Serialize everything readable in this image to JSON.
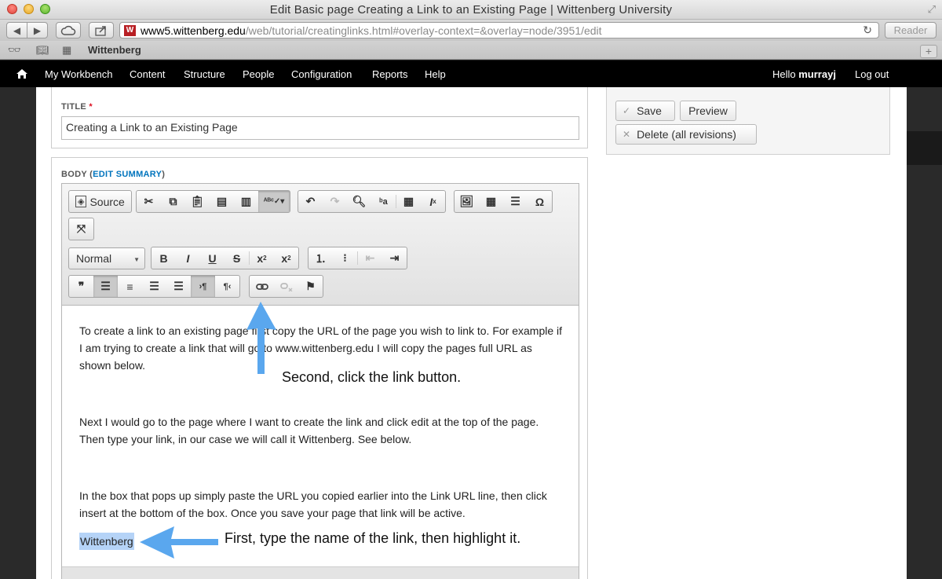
{
  "window": {
    "title": "Edit Basic page Creating a Link to an Existing Page | Wittenberg University"
  },
  "browser": {
    "url_host": "www5.wittenberg.edu",
    "url_rest": "/web/tutorial/creatinglinks.html#overlay-context=&overlay=node/3951/edit",
    "reader_label": "Reader",
    "bookmark_label": "Wittenberg",
    "icons": [
      "back-icon",
      "forward-icon",
      "icloud-icon",
      "share-icon",
      "reload-icon",
      "reading-list-icon",
      "bookmarks-icon",
      "top-sites-icon",
      "new-tab-icon"
    ]
  },
  "adminbar": {
    "menu": [
      "My Workbench",
      "Content",
      "Structure",
      "People",
      "Configuration",
      "Reports",
      "Help"
    ],
    "hello_prefix": "Hello ",
    "username": "murrayj",
    "logout": "Log out"
  },
  "form": {
    "title_label": "TITLE",
    "required_mark": "*",
    "title_value": "Creating a Link to an Existing Page",
    "body_label": "BODY",
    "edit_summary_open": " (",
    "edit_summary_link": "EDIT SUMMARY",
    "edit_summary_close": ")"
  },
  "editor": {
    "source_label": "Source",
    "format_value": "Normal",
    "paragraphs": [
      "To create a link to an existing page first copy the URL of the page you wish to link to. For example if I am trying to create a link that will go to www.wittenberg.edu I will copy the pages full URL as shown below.",
      "Next I would go to the page where I want to create the link and click edit at the top of the page. Then type your link, in our case we will call it Wittenberg. See below.",
      "In the box that pops up simply paste the URL you copied earlier into the Link URL line, then click insert at the bottom of the box. Once you save your page that link will be active."
    ],
    "highlighted_word": "Wittenberg"
  },
  "sidebar": {
    "save_label": "Save",
    "preview_label": "Preview",
    "delete_label": "Delete (all revisions)"
  },
  "annotations": {
    "second": "Second, click the link button.",
    "first": "First, type the name of the link, then highlight it."
  },
  "colors": {
    "accent_link": "#0074bd",
    "highlight": "#b5d3f7",
    "arrow": "#5aa7ee",
    "admin_bar": "#000000"
  }
}
